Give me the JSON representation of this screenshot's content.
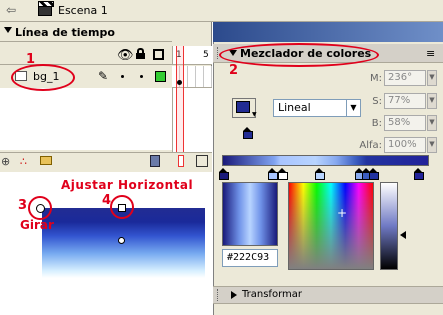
{
  "scene_bar": {
    "scene_label": "Escena 1"
  },
  "timeline": {
    "title": "Línea de tiempo",
    "layers": [
      {
        "name": "bg_1"
      }
    ],
    "frame_ruler": [
      "1",
      "5"
    ]
  },
  "annotations": {
    "num1": "1",
    "num2": "2",
    "num3": "3",
    "num4": "4",
    "ajustar_horizontal": "Ajustar Horizontal",
    "girar": "Girar"
  },
  "mixer": {
    "title": "Mezclador de colores",
    "menu_icon": "≡",
    "type_select": "Lineal",
    "fields": {
      "m": {
        "label": "M:",
        "value": "236°"
      },
      "s": {
        "label": "S:",
        "value": "77%"
      },
      "b": {
        "label": "B:",
        "value": "58%"
      },
      "alfa": {
        "label": "Alfa:",
        "value": "100%"
      }
    },
    "hex_value": "#222C93",
    "selected_color": "#222c93",
    "transform_label": "Transformar"
  }
}
